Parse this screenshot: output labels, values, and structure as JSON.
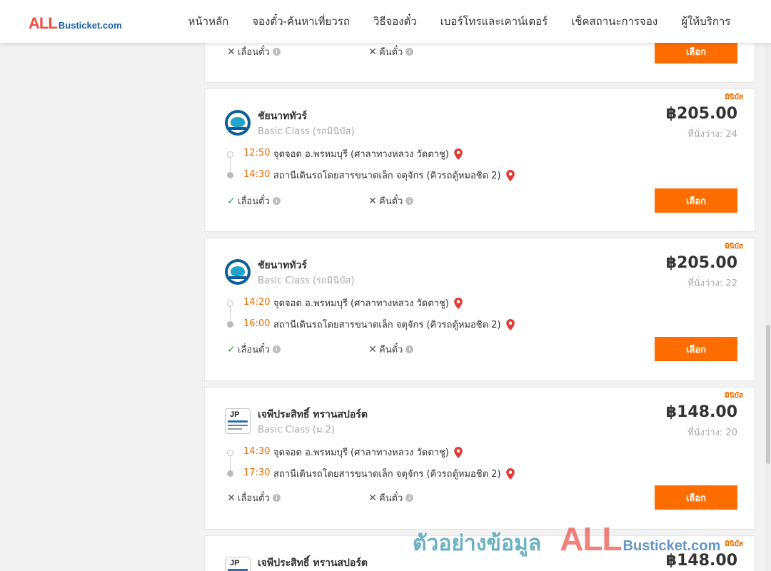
{
  "header": {
    "logo_all": "ALL",
    "logo_rest": "Busticket.com",
    "nav": [
      "หน้าหลัก",
      "จองตั๋ว-ค้นหาเที่ยวรถ",
      "วิธีจองตั๋ว",
      "เบอร์โทรและเคาน์เตอร์",
      "เช็คสถานะการจอง",
      "ผู้ให้บริการ"
    ]
  },
  "top_card": {
    "reserve_label": "เลื่อนตั๋ว",
    "refund_label": "คืนตั๋ว",
    "button": "เลือก"
  },
  "cards": [
    {
      "badge": "มินิบัส",
      "company": "ชัยนาททัวร์",
      "bus_class": "Basic Class (รถมินิบัส)",
      "price": "฿205.00",
      "seats": "ที่นั่งว่าง: 24",
      "depart_time": "12:50",
      "depart_stop": "จุดจอด อ.พรหมบุรี (ศาลาทางหลวง วัดตาชู)",
      "arrive_time": "14:30",
      "arrive_stop": "สถานีเดินรถโดยสารขนาดเล็ก จตุจักร (คิวรถตู้หมอชิต 2)",
      "reschedule_label": "เลื่อนตั๋ว",
      "reschedule_allowed": true,
      "refund_label": "คืนตั๋ว",
      "refund_allowed": false,
      "button": "เลือก"
    },
    {
      "badge": "มินิบัส",
      "company": "ชัยนาททัวร์",
      "bus_class": "Basic Class (รถมินิบัส)",
      "price": "฿205.00",
      "seats": "ที่นั่งว่าง: 22",
      "depart_time": "14:20",
      "depart_stop": "จุดจอด อ.พรหมบุรี (ศาลาทางหลวง วัดตาชู)",
      "arrive_time": "16:00",
      "arrive_stop": "สถานีเดินรถโดยสารขนาดเล็ก จตุจักร (คิวรถตู้หมอชิต 2)",
      "reschedule_label": "เลื่อนตั๋ว",
      "reschedule_allowed": true,
      "refund_label": "คืนตั๋ว",
      "refund_allowed": false,
      "button": "เลือก"
    },
    {
      "badge": "มินิบัส",
      "company": "เจพีประสิทธิ์ ทรานสปอร์ต",
      "bus_class": "Basic Class (ม.2)",
      "price": "฿148.00",
      "seats": "ที่นั่งว่าง: 20",
      "depart_time": "14:30",
      "depart_stop": "จุดจอด อ.พรหมบุรี (ศาลาทางหลวง วัดตาชู)",
      "arrive_time": "17:30",
      "arrive_stop": "สถานีเดินรถโดยสารขนาดเล็ก จตุจักร (คิวรถตู้หมอชิต 2)",
      "reschedule_label": "เลื่อนตั๋ว",
      "reschedule_allowed": false,
      "refund_label": "คืนตั๋ว",
      "refund_allowed": false,
      "button": "เลือก"
    },
    {
      "badge": "มินิบัส",
      "company": "เจพีประสิทธิ์ ทรานสปอร์ต",
      "price": "฿148.00"
    }
  ],
  "watermark": {
    "text": "ตัวอย่างข้อมูล",
    "all": "ALL",
    "rest": "Busticket.com"
  },
  "colors": {
    "accent": "#ff6c00",
    "time": "#f06a00",
    "check": "#2ca44a",
    "pin": "#e53935"
  }
}
